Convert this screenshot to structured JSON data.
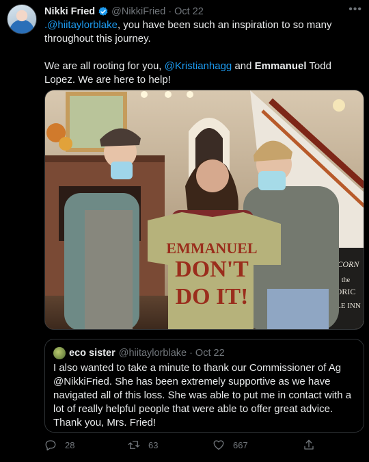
{
  "tweet": {
    "author": {
      "name": "Nikki Fried",
      "handle": "@NikkiFried",
      "separator": "·",
      "date": "Oct 22",
      "verified_color": "#1d9bf0"
    },
    "more_label": "•••",
    "text": {
      "p1_mention": ".@hiitaylorblake",
      "p1_rest": ", you have been such an inspiration to so many throughout this journey.",
      "p2_start": "We are all rooting for you, ",
      "p2_mention": "@Kristianhagg",
      "p2_and": " and ",
      "p2_bold": "Emmanuel",
      "p2_end": " Todd Lopez. We are here to help!"
    },
    "photo": {
      "shirt_line1": "EMMANUEL",
      "shirt_line2": "DON'T",
      "shirt_line3": "DO IT!",
      "sign_text": "ALCORN ... the HISTORIC ... POLE INN"
    },
    "quote": {
      "name": "eco sister",
      "handle": "@hiitaylorblake",
      "separator": "·",
      "date": "Oct 22",
      "text": "I also wanted to take a minute to thank our Commissioner of Ag @NikkiFried. She has been extremely supportive as we have navigated all of this loss. She was able to put me in contact with a lot of really helpful people that were able to offer great advice. Thank you, Mrs. Fried!"
    },
    "actions": {
      "replies": "28",
      "retweets": "63",
      "likes": "667",
      "icon_color": "#71767b"
    }
  }
}
